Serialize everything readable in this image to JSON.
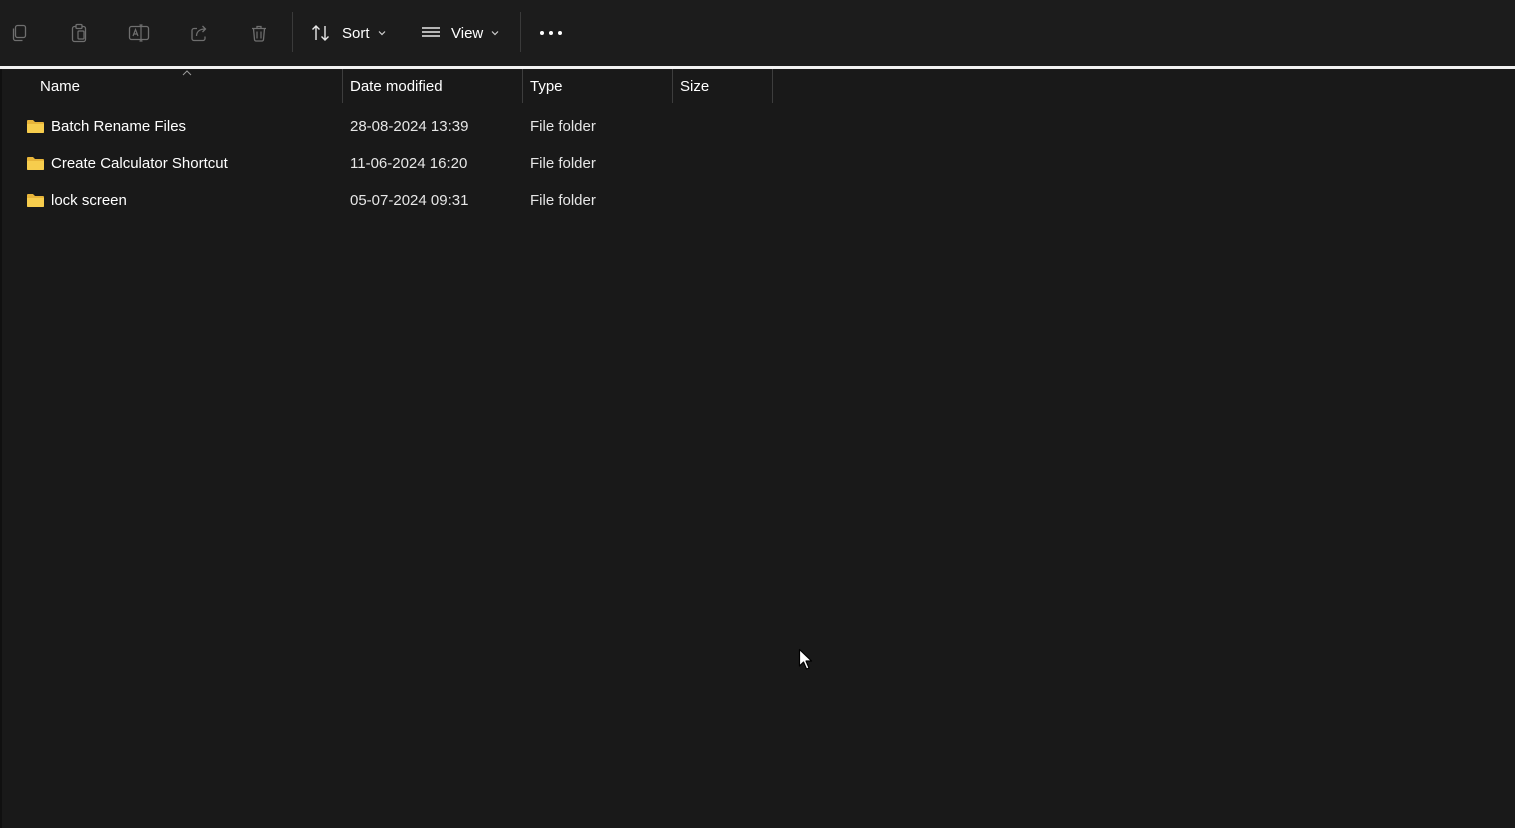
{
  "toolbar": {
    "icons": [
      "copy-icon",
      "paste-icon",
      "rename-icon",
      "share-icon",
      "delete-icon"
    ],
    "sort_label": "Sort",
    "view_label": "View",
    "more_icon": "more-horizontal-icon"
  },
  "columns": {
    "name": "Name",
    "date_modified": "Date modified",
    "type": "Type",
    "size": "Size",
    "sorted_by": "Name",
    "sort_direction": "ascending"
  },
  "files": [
    {
      "name": "Batch Rename Files",
      "date_modified": "28-08-2024 13:39",
      "type": "File folder",
      "size": ""
    },
    {
      "name": "Create Calculator Shortcut",
      "date_modified": "11-06-2024 16:20",
      "type": "File folder",
      "size": ""
    },
    {
      "name": "lock screen",
      "date_modified": "05-07-2024 09:31",
      "type": "File folder",
      "size": ""
    }
  ],
  "colors": {
    "background": "#191919",
    "folder": "#f4c542",
    "icon_dim": "#7a7a7a"
  }
}
